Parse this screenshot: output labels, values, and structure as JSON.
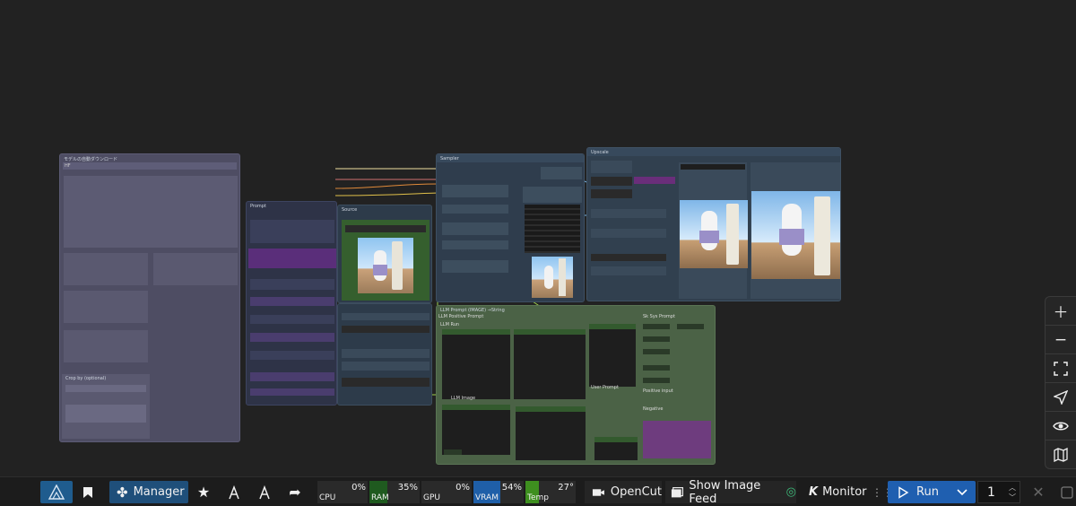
{
  "canvas": {
    "nodes": {
      "model_download": {
        "title": "モデルの自動ダウンロード",
        "sub": "HF"
      },
      "model_crop": {
        "title": "Crop by (optional)"
      },
      "prompt": {
        "title": "Prompt"
      },
      "sampler": {
        "title": "Sampler"
      },
      "upscale": {
        "title": "Upscale"
      },
      "source": {
        "title": "Source"
      },
      "llm": {
        "title": "LLM Prompt (IMAGE) →String",
        "positive": "LLM Positive Prompt",
        "run": "LLM Run",
        "sdxl": "Sk Sys Prompt",
        "positive_input": "Positive input",
        "negative": "Negative",
        "user_prompt": "User Prompt",
        "llm_image": "LLM Image"
      }
    }
  },
  "right_toolbar": {
    "icons": [
      "plus-icon",
      "minus-icon",
      "fit-view-icon",
      "locate-icon",
      "eye-icon",
      "map-icon"
    ]
  },
  "toolbar": {
    "manager_label": "Manager",
    "meters": {
      "cpu": {
        "label": "CPU",
        "value": "0%",
        "fraction": 0.0
      },
      "ram": {
        "label": "RAM",
        "value": "35%",
        "fraction": 0.35
      },
      "gpu": {
        "label": "GPU",
        "value": "0%",
        "fraction": 0.0
      },
      "vram": {
        "label": "VRAM",
        "value": "54%",
        "fraction": 0.54
      },
      "temp": {
        "label": "Temp",
        "value": "27°",
        "fraction": 0.27
      }
    },
    "opencut_label": "OpenCut",
    "image_feed_label": "Show Image Feed",
    "monitor_label": "Monitor",
    "run_label": "Run",
    "queue_count": "1"
  },
  "colors": {
    "accent": "#1f6fb7",
    "ram_fill": "#1f5a1f",
    "vram_fill": "#1f5fa8",
    "temp_fill": "#3e8f1f"
  }
}
